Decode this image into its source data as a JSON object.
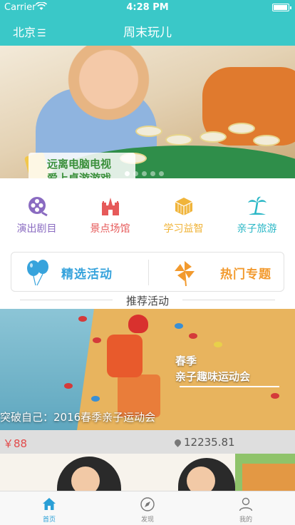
{
  "status_bar": {
    "carrier": "Carrier",
    "time": "4:28 PM",
    "wifi_icon": "wifi-icon",
    "battery_icon": "battery-icon"
  },
  "nav": {
    "city": "北京",
    "city_icon": "☰",
    "title": "周末玩儿"
  },
  "banner": {
    "caption": "远离电脑电视\n爱上桌游游戏",
    "page_count": 5,
    "active_page": 0
  },
  "categories": [
    {
      "label": "演出剧目",
      "icon": "film-reel-icon",
      "color": "#8a6bc1"
    },
    {
      "label": "景点场馆",
      "icon": "castle-icon",
      "color": "#e65a5a"
    },
    {
      "label": "学习益智",
      "icon": "cube-icon",
      "color": "#f0b43a"
    },
    {
      "label": "亲子旅游",
      "icon": "palm-tree-icon",
      "color": "#2ab7c6"
    }
  ],
  "features": [
    {
      "label": "精选活动",
      "icon": "balloons-icon",
      "color": "#37a3dc"
    },
    {
      "label": "热门专题",
      "icon": "pinwheel-icon",
      "color": "#f29a2e"
    }
  ],
  "section": {
    "title": "推荐活动"
  },
  "events": [
    {
      "overlay_line1": "春季",
      "overlay_line2": "亲子趣味运动会",
      "title": "突破自己：2016春季亲子运动会",
      "price": "￥88",
      "distance": "12235.81"
    }
  ],
  "tabs": [
    {
      "label": "首页",
      "icon": "home-icon",
      "active": true
    },
    {
      "label": "发现",
      "icon": "compass-icon",
      "active": false
    },
    {
      "label": "我的",
      "icon": "user-icon",
      "active": false
    }
  ],
  "colors": {
    "brand": "#3ac8c8",
    "price": "#e24a4a",
    "tab_active": "#2a9fd6"
  }
}
